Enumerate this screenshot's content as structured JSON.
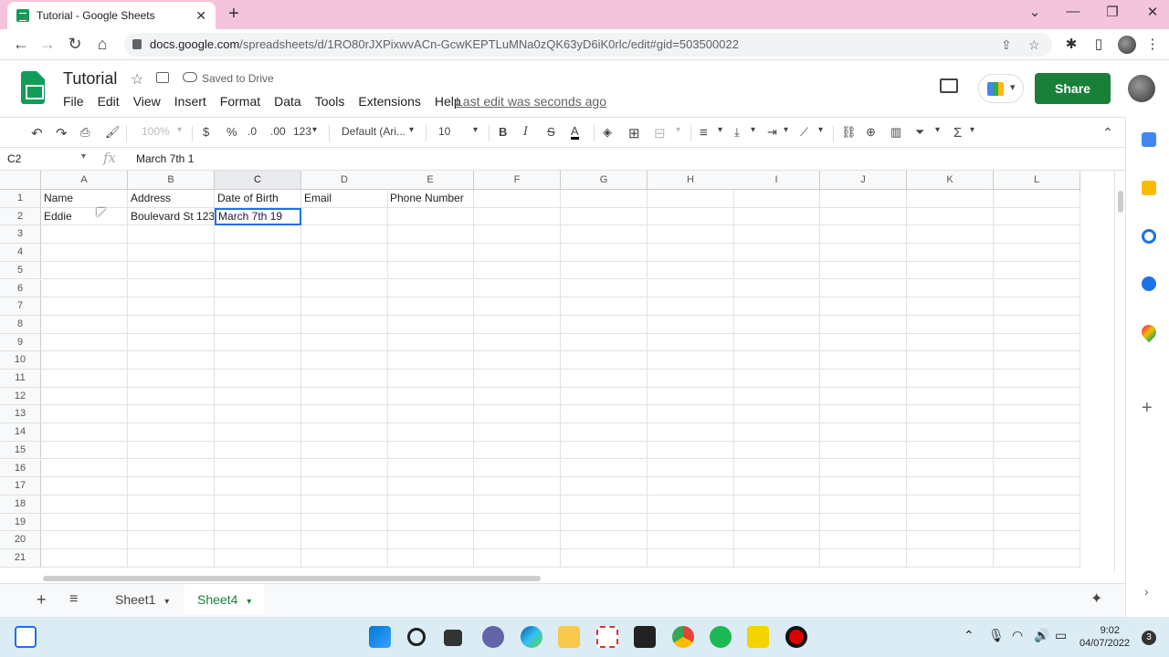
{
  "browser": {
    "tab_title": "Tutorial - Google Sheets",
    "tab_close": "✕",
    "new_tab": "+",
    "url_host": "docs.google.com",
    "url_path": "/spreadsheets/d/1RO80rJXPixwvACn-GcwKEPTLuMNa0zQK63yD6iK0rlc/edit#gid=503500022",
    "win_min": "⌄",
    "win_restore": "—",
    "win_max": "❐",
    "win_close": "✕"
  },
  "app": {
    "title": "Tutorial",
    "saved_status": "Saved to Drive",
    "menu": [
      "File",
      "Edit",
      "View",
      "Insert",
      "Format",
      "Data",
      "Tools",
      "Extensions",
      "Help"
    ],
    "last_edit": "Last edit was seconds ago",
    "share_label": "Share"
  },
  "toolbar": {
    "zoom": "100%",
    "currency": "$",
    "percent": "%",
    "dec_decrease": ".0",
    "dec_increase": ".00",
    "more_formats": "123",
    "font": "Default (Ari...",
    "font_size": "10",
    "bold": "B",
    "italic": "I",
    "strike": "S",
    "text_color": "A",
    "sum": "Σ"
  },
  "formula_bar": {
    "name_box": "C2",
    "fx": "fx",
    "value": "March 7th 1"
  },
  "sheet": {
    "columns": [
      "A",
      "B",
      "C",
      "D",
      "E",
      "F",
      "G",
      "H",
      "I",
      "J",
      "K",
      "L"
    ],
    "rows": [
      "1",
      "2",
      "3",
      "4",
      "5",
      "6",
      "7",
      "8",
      "9",
      "10",
      "11",
      "12",
      "13",
      "14",
      "15",
      "16",
      "17",
      "18",
      "19",
      "20",
      "21"
    ],
    "cells": {
      "A1": "Name",
      "B1": "Address",
      "C1": "Date of Birth",
      "D1": "Email",
      "E1": "Phone Number",
      "A2": "Eddie",
      "B2": "Boulevard St 123",
      "C2": "March 7th 19"
    },
    "active_cell": "C2"
  },
  "sheets": {
    "add": "+",
    "list": "≡",
    "tabs": [
      {
        "label": "Sheet1",
        "active": false
      },
      {
        "label": "Sheet4",
        "active": true
      }
    ]
  },
  "taskbar": {
    "time": "9:02",
    "date": "04/07/2022",
    "notifications": "3"
  },
  "colors": {
    "accent_green": "#188038",
    "selection_blue": "#1a73e8",
    "titlebar_pink": "#f4c4dc"
  }
}
